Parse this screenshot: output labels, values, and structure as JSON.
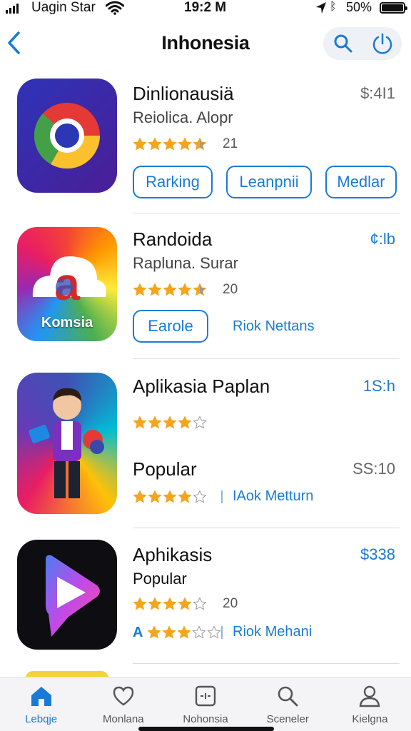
{
  "status_bar": {
    "carrier": "Uagin Star",
    "time": "19:2 M",
    "battery": "50%"
  },
  "nav": {
    "title": "Inhonesia"
  },
  "apps": [
    {
      "name": "Dinlionausiä",
      "subtitle": "Reiolica. Alopr",
      "price": "$:4I1",
      "rating_stars": 4.5,
      "rating_count": "21",
      "buttons": [
        "Rarking",
        "Leanpnii",
        "Medlar"
      ]
    },
    {
      "name": "Randoida",
      "subtitle": "Raplunа. Surar",
      "price": "¢:lb",
      "rating_stars": 4.5,
      "rating_count": "20",
      "icon_text": "Komsia",
      "button": "Earole",
      "link": "Riok Nettans"
    },
    {
      "name": "Aplikasia Paplan",
      "price": "1S:h",
      "rating_stars": 4,
      "name2": "Popular",
      "price2": "SS:10",
      "rating2_stars": 4,
      "link": "IAok Metturn"
    },
    {
      "name": "Aphikasis",
      "subtitle": "Popular",
      "price": "$338",
      "rating_stars": 4,
      "rating_count": "20",
      "rating2_stars": 3,
      "rating2_prefix": "A",
      "link": "Riok Mehani"
    }
  ],
  "tabs": [
    {
      "label": "Lebqje",
      "icon": "home-icon",
      "active": true
    },
    {
      "label": "Monlana",
      "icon": "heart-icon",
      "active": false
    },
    {
      "label": "Nohonsia",
      "icon": "frame-icon",
      "active": false
    },
    {
      "label": "Sceneler",
      "icon": "search-icon",
      "active": false
    },
    {
      "label": "Kielgna",
      "icon": "person-icon",
      "active": false
    }
  ],
  "colors": {
    "accent": "#1a7bd6",
    "star": "#f4a51c",
    "star_empty": "#9a9a9a"
  }
}
